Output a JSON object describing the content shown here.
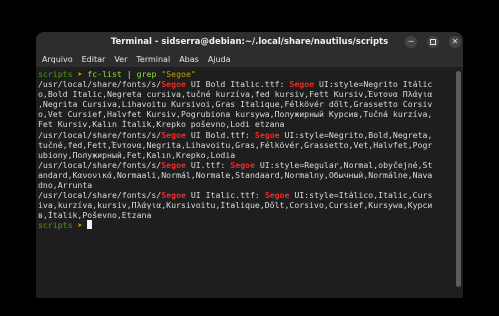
{
  "window": {
    "title": "Terminal - sidserra@debian:~/.local/share/nautilus/scripts",
    "minimize_glyph": "─",
    "close_glyph": "✕"
  },
  "menubar": {
    "items": [
      "Arquivo",
      "Editar",
      "Ver",
      "Terminal",
      "Abas",
      "Ajuda"
    ]
  },
  "terminal": {
    "prompt": {
      "dir": "scripts",
      "arrow": "➤"
    },
    "command": {
      "part1": "fc-list",
      "pipe": "|",
      "part2": "grep",
      "arg": "\"Segoe\""
    },
    "lines": [
      [
        "/usr/local/share/fonts/s/",
        "Segoe",
        " UI Bold Italic.ttf: ",
        "Segoe",
        " UI:style=Negrito Itálic"
      ],
      [
        "o,Bold Italic,Negreta cursiva,tučné kurzíva,fed kursiv,Fett Kursiv,Έντονα Πλάγια"
      ],
      [
        ",Negrita Cursiva,Lihavoitu Kursivoi,Gras Italique,Félkövér dőlt,Grassetto Corsiv"
      ],
      [
        "o,Vet Cursief,Halvfet Kursiv,Pogrubiona kursywa,Полужирный Курсив,Tučná kurzíva,"
      ],
      [
        "Fet Kursiv,Kalın İtalik,Krepko poševno,Lodi etzana"
      ],
      [
        "/usr/local/share/fonts/s/",
        "Segoe",
        " UI Bold.ttf: ",
        "Segoe",
        " UI:style=Negrito,Bold,Negreta,"
      ],
      [
        "tučné,fed,Fett,Έντονα,Negrita,Lihavoitu,Gras,Félkövér,Grassetto,Vet,Halvfet,Pogr"
      ],
      [
        "ubiony,Полужирный,Fet,Kalın,Krepko,Lodia"
      ],
      [
        "/usr/local/share/fonts/s/",
        "Segoe",
        " UI.ttf: ",
        "Segoe",
        " UI:style=Regular,Normal,obyčejné,St"
      ],
      [
        "andard,Κανονικά,Normaali,Normál,Normale,Standaard,Normalny,Обычный,Normálne,Nava"
      ],
      [
        "dno,Arrunta"
      ],
      [
        "/usr/local/share/fonts/s/",
        "Segoe",
        " UI Italic.ttf: ",
        "Segoe",
        " UI:style=Itálico,Italic,Curs"
      ],
      [
        "iva,kurzíva,kursiv,Πλάγια,Kursivoitu,Italique,Dőlt,Corsivo,Cursief,Kursywa,Курси"
      ],
      [
        "в,İtalik,Poševno,Etzana"
      ]
    ],
    "scroll_fraction": 1.0
  }
}
